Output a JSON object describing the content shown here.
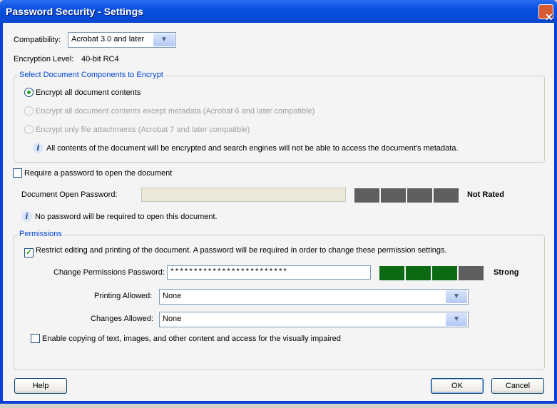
{
  "window": {
    "title": "Password Security - Settings"
  },
  "compatibility": {
    "label": "Compatibility:",
    "value": "Acrobat 3.0 and later"
  },
  "encryption": {
    "label": "Encryption  Level:",
    "value": "40-bit RC4"
  },
  "components": {
    "legend": "Select Document Components to Encrypt",
    "options": [
      {
        "label": "Encrypt all document contents",
        "selected": true,
        "enabled": true
      },
      {
        "label": "Encrypt all document contents except metadata (Acrobat 6 and later compatible)",
        "selected": false,
        "enabled": false
      },
      {
        "label": "Encrypt only file attachments (Acrobat 7 and later compatible)",
        "selected": false,
        "enabled": false
      }
    ],
    "info": "All contents of the document will be encrypted and search engines will not be able to access the document's metadata."
  },
  "open_password": {
    "checkbox_label": "Require a password to open the document",
    "checked": false,
    "label": "Document Open Password:",
    "value": "",
    "strength_segments": 0,
    "strength_total": 4,
    "rating": "Not Rated",
    "info": "No password will be required to open this document."
  },
  "permissions": {
    "legend": "Permissions",
    "restrict_label": "Restrict editing and printing of the document. A password will be required in order to change these permission settings.",
    "restrict_checked": true,
    "password_label": "Change Permissions Password:",
    "password_value": "*************************",
    "strength_segments": 3,
    "strength_total": 4,
    "rating": "Strong",
    "printing_label": "Printing Allowed:",
    "printing_value": "None",
    "changes_label": "Changes Allowed:",
    "changes_value": "None",
    "copy_label": "Enable copying of text, images, and other content and access for the visually impaired",
    "copy_checked": false
  },
  "buttons": {
    "help": "Help",
    "ok": "OK",
    "cancel": "Cancel",
    "close": "✕"
  },
  "colors": {
    "strength_on": "#0d6a14",
    "strength_off": "#5e5e5e",
    "accent": "#0046d5"
  }
}
